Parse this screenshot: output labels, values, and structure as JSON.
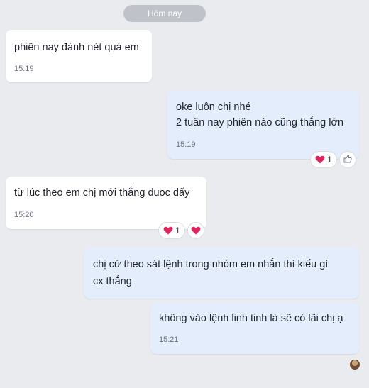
{
  "date_separator": "Hôm nay",
  "messages": [
    {
      "direction": "incoming",
      "text": "phiên nay đánh nét quá em",
      "time": "15:19"
    },
    {
      "direction": "outgoing",
      "text": "oke luôn chị nhé\n2 tuần nay phiên nào cũng thắng lớn",
      "time": "15:19",
      "reactions": {
        "heart_count": "1",
        "like_icon": "thumbs-up-icon"
      }
    },
    {
      "direction": "incoming",
      "text": "từ lúc theo em chị mới thắng đuoc đấy",
      "time": "15:20",
      "reactions": {
        "heart_count": "1",
        "add_heart_icon": "heart-icon"
      }
    },
    {
      "direction": "outgoing",
      "text": "chị cứ theo sát lệnh trong nhóm em nhắn thì kiểu gì\ncx thắng"
    },
    {
      "direction": "outgoing",
      "text": "không vào lệnh linh tinh là sẽ có lãi chị ạ",
      "time": "15:21"
    }
  ],
  "colors": {
    "background": "#e9ebef",
    "incoming_bubble": "#ffffff",
    "outgoing_bubble": "#e3edfc",
    "heart": "#e0245e"
  }
}
